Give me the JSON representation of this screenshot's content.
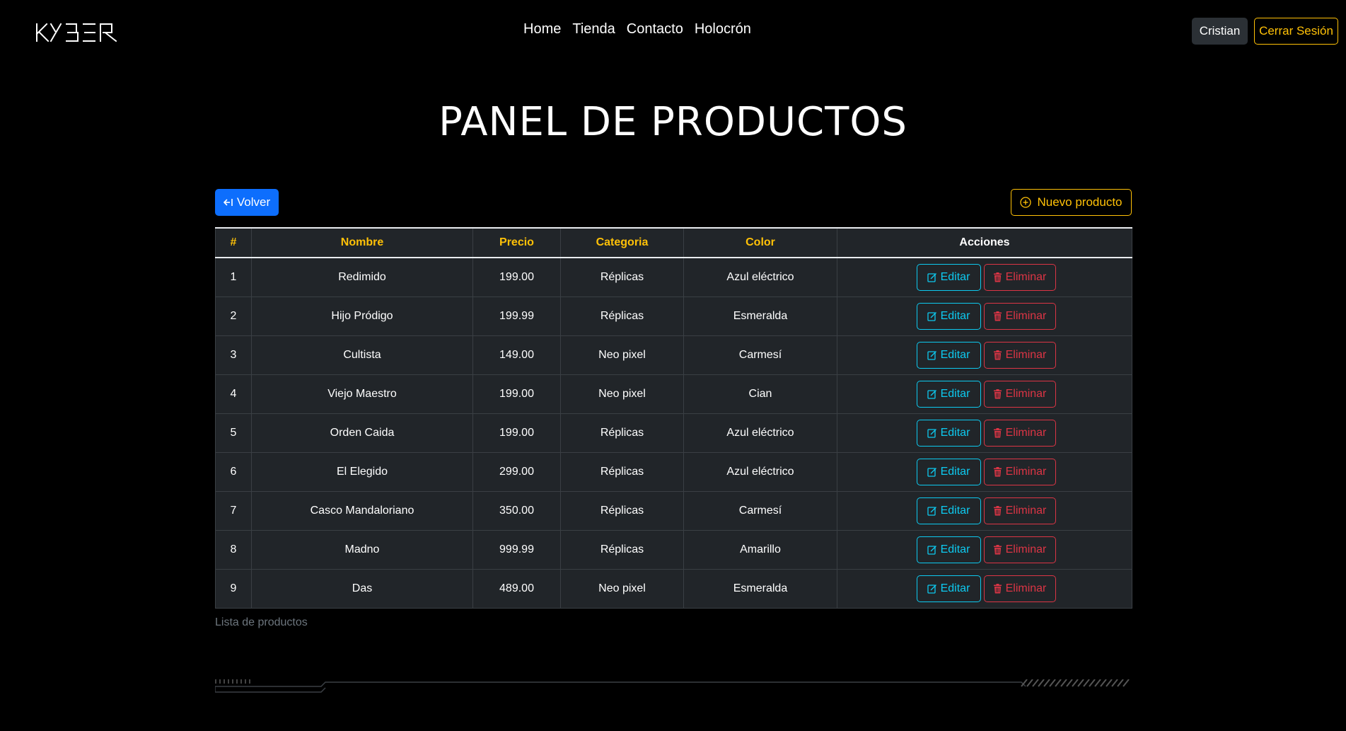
{
  "nav": {
    "logo_text": "KYBER",
    "links": [
      "Home",
      "Tienda",
      "Contacto",
      "Holocrón"
    ],
    "user_label": "Cristian",
    "logout_label": "Cerrar Sesión"
  },
  "page": {
    "title": "PANEL DE PRODUCTOS",
    "back_label": "Volver",
    "new_label": "Nuevo producto",
    "caption": "Lista de productos"
  },
  "table": {
    "headers": [
      "#",
      "Nombre",
      "Precio",
      "Categoria",
      "Color",
      "Acciones"
    ],
    "edit_label": "Editar",
    "delete_label": "Eliminar",
    "rows": [
      {
        "id": "1",
        "name": "Redimido",
        "price": "199.00",
        "category": "Réplicas",
        "color": "Azul eléctrico"
      },
      {
        "id": "2",
        "name": "Hijo Pródigo",
        "price": "199.99",
        "category": "Réplicas",
        "color": "Esmeralda"
      },
      {
        "id": "3",
        "name": "Cultista",
        "price": "149.00",
        "category": "Neo pixel",
        "color": "Carmesí"
      },
      {
        "id": "4",
        "name": "Viejo Maestro",
        "price": "199.00",
        "category": "Neo pixel",
        "color": "Cian"
      },
      {
        "id": "5",
        "name": "Orden Caida",
        "price": "199.00",
        "category": "Réplicas",
        "color": "Azul eléctrico"
      },
      {
        "id": "6",
        "name": "El Elegido",
        "price": "299.00",
        "category": "Réplicas",
        "color": "Azul eléctrico"
      },
      {
        "id": "7",
        "name": "Casco Mandaloriano",
        "price": "350.00",
        "category": "Réplicas",
        "color": "Carmesí"
      },
      {
        "id": "8",
        "name": "Madno",
        "price": "999.99",
        "category": "Réplicas",
        "color": "Amarillo"
      },
      {
        "id": "9",
        "name": "Das",
        "price": "489.00",
        "category": "Neo pixel",
        "color": "Esmeralda"
      }
    ]
  },
  "colors": {
    "accent": "#ffc107",
    "primary": "#0d6efd",
    "info": "#0dcaf0",
    "danger": "#dc3545",
    "table_bg": "#212529"
  },
  "icons": {
    "back": "arrow-left-bar-icon",
    "new": "plus-circle-icon",
    "edit": "pencil-square-icon",
    "delete": "trash-icon"
  }
}
